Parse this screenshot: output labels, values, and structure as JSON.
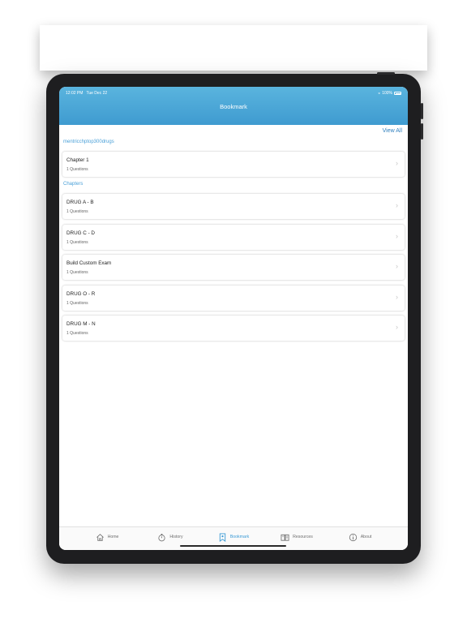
{
  "status_bar": {
    "time": "12:02 PM",
    "date": "Tue Dec 22",
    "battery": "100%"
  },
  "nav": {
    "title": "Bookmark",
    "view_all": "View All"
  },
  "course_section": {
    "label": "mentricchptop300drugs",
    "items": [
      {
        "title": "Chapter 1",
        "subtitle": "1 Questions"
      }
    ]
  },
  "chapters_section": {
    "label": "Chapters",
    "items": [
      {
        "title": "DRUG A - B",
        "subtitle": "1 Questions"
      },
      {
        "title": "DRUG C - D",
        "subtitle": "1 Questions"
      },
      {
        "title": "Build Custom Exam",
        "subtitle": "1 Questions"
      },
      {
        "title": "DRUG O - R",
        "subtitle": "1 Questions"
      },
      {
        "title": "DRUG M - N",
        "subtitle": "1 Questions"
      }
    ]
  },
  "tabbar": {
    "items": [
      {
        "label": "Home",
        "icon": "home-icon"
      },
      {
        "label": "History",
        "icon": "stopwatch-icon"
      },
      {
        "label": "Bookmark",
        "icon": "bookmark-icon",
        "active": true
      },
      {
        "label": "Resources",
        "icon": "book-icon"
      },
      {
        "label": "About",
        "icon": "info-icon"
      }
    ]
  },
  "colors": {
    "accent": "#3a9ad5",
    "header_top": "#5ab4de",
    "header_bottom": "#3f9bd0"
  }
}
